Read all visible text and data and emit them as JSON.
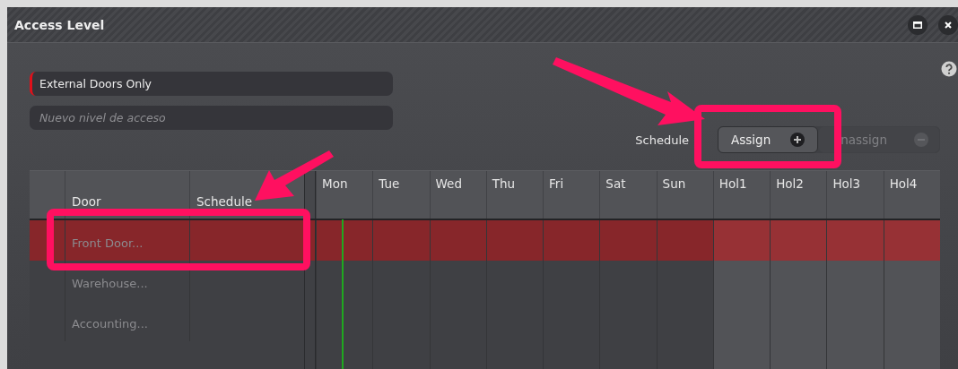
{
  "window": {
    "title": "Access Level"
  },
  "fields": [
    {
      "value": "External Doors Only",
      "required": true
    },
    {
      "placeholder": "Nuevo nivel de acceso",
      "required": false
    }
  ],
  "schedule_actions": {
    "label": "Schedule",
    "buttons": [
      {
        "label": "Assign",
        "kind": "assign",
        "disabled": false
      },
      {
        "label": "nassign",
        "kind": "unassign",
        "disabled": true
      }
    ]
  },
  "table": {
    "columns": [
      {
        "label": "Door",
        "kind": "text"
      },
      {
        "label": "Schedule",
        "kind": "text"
      },
      {
        "label": "Mon",
        "kind": "day"
      },
      {
        "label": "Tue",
        "kind": "day"
      },
      {
        "label": "Wed",
        "kind": "day"
      },
      {
        "label": "Thu",
        "kind": "day"
      },
      {
        "label": "Fri",
        "kind": "day"
      },
      {
        "label": "Sat",
        "kind": "day"
      },
      {
        "label": "Sun",
        "kind": "day"
      },
      {
        "label": "Hol1",
        "kind": "holiday"
      },
      {
        "label": "Hol2",
        "kind": "holiday"
      },
      {
        "label": "Hol3",
        "kind": "holiday"
      },
      {
        "label": "Hol4",
        "kind": "holiday"
      }
    ],
    "rows": [
      {
        "door": "Front Door...",
        "selected": true
      },
      {
        "door": "Warehouse...",
        "selected": false
      },
      {
        "door": "Accounting...",
        "selected": false
      }
    ]
  }
}
